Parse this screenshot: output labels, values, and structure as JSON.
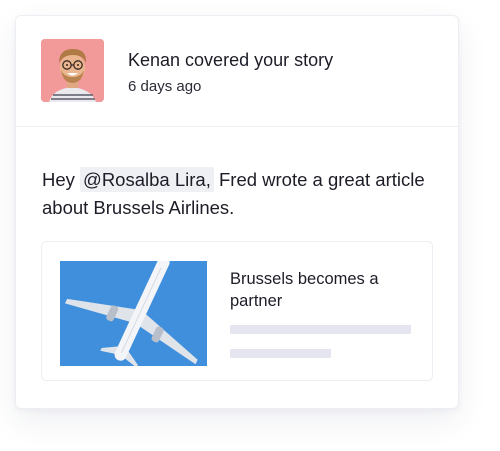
{
  "notification": {
    "title": "Kenan covered your story",
    "time": "6 days ago"
  },
  "message": {
    "prefix": "Hey ",
    "mention": "@Rosalba Lira,",
    "suffix": " Fred wrote a great article about Brussels Airlines."
  },
  "article": {
    "title": "Brussels becomes a partner"
  },
  "colors": {
    "avatar_bg": "#f2999a",
    "thumb_sky": "#3d8edb",
    "placeholder": "#e4e5ee",
    "mention_bg": "#eef0f4"
  },
  "icons": {
    "avatar": "user-avatar-photo",
    "thumbnail": "airplane-photo"
  }
}
